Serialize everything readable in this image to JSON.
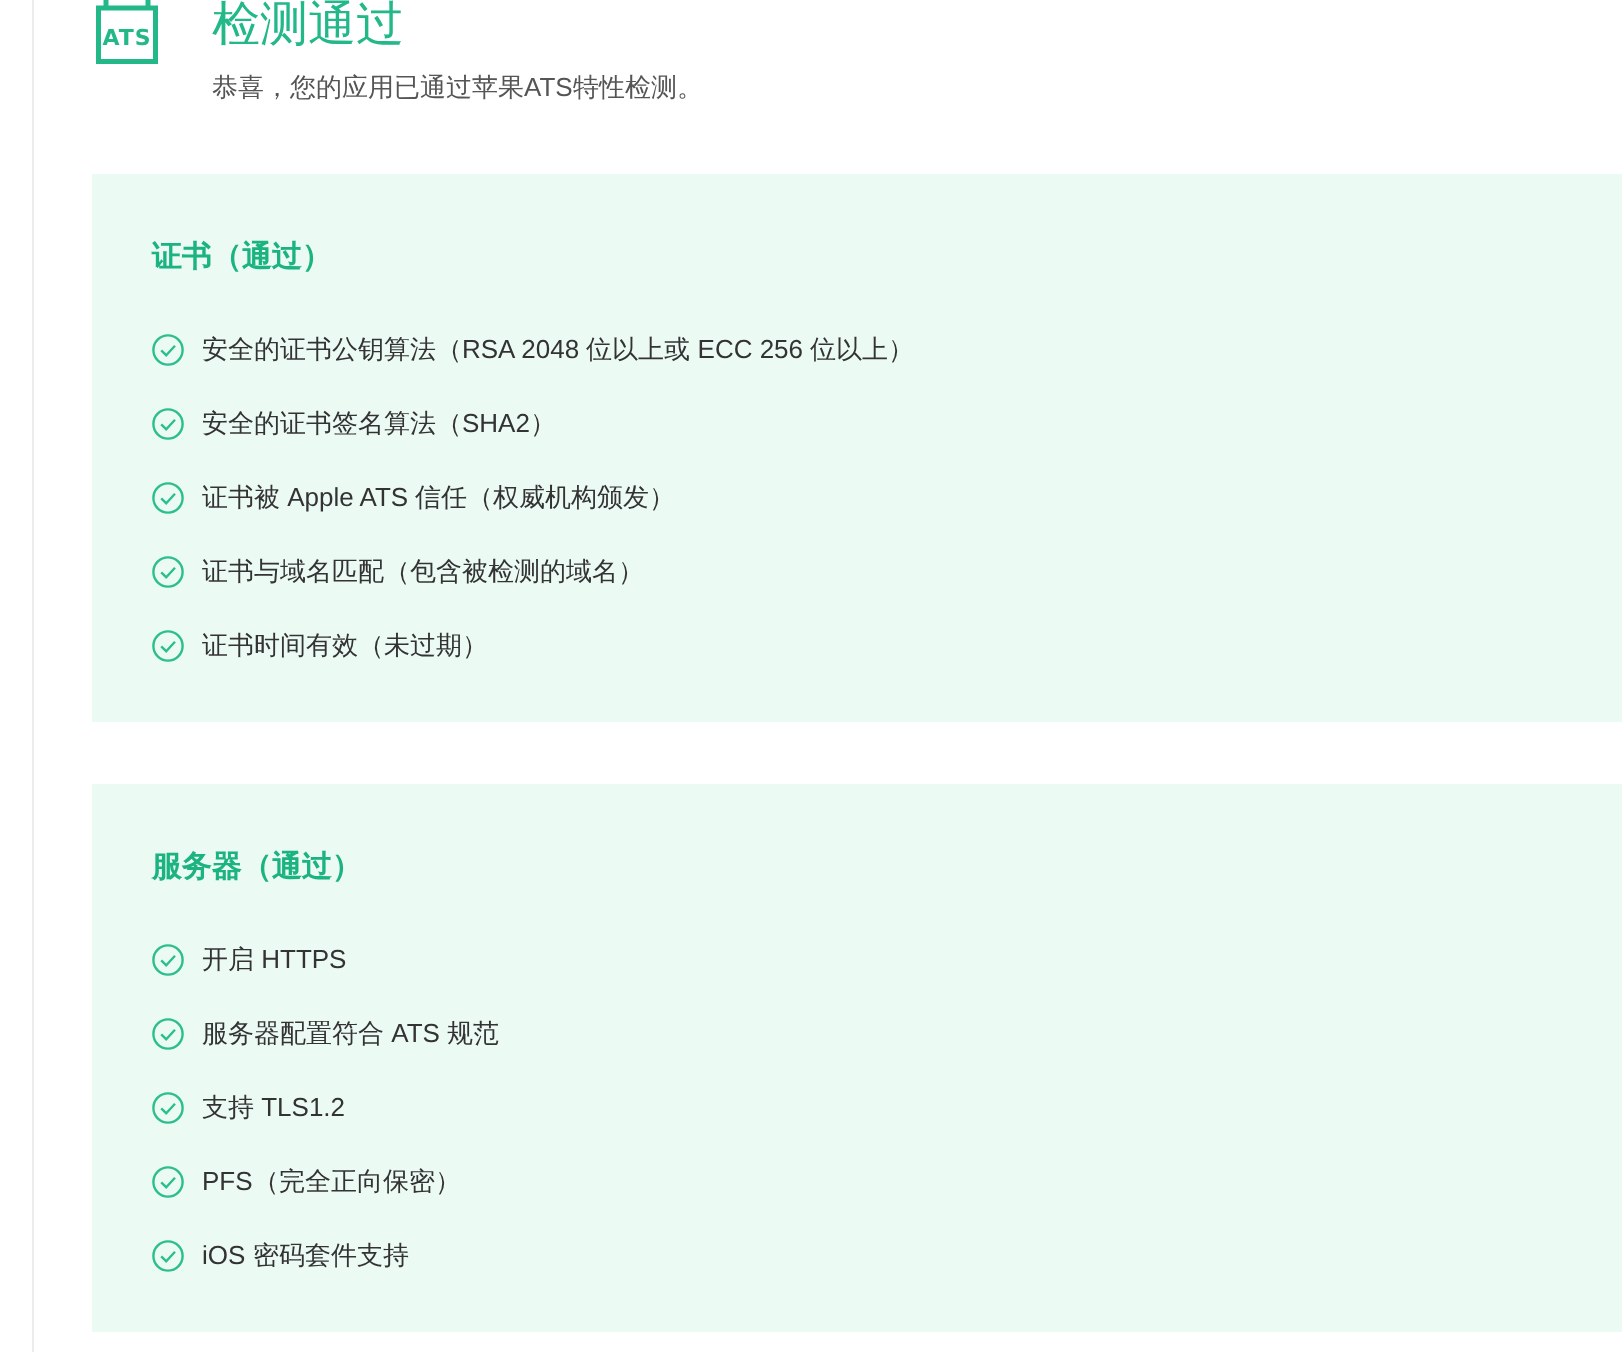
{
  "header": {
    "logo_text": "ATS",
    "title": "检测通过",
    "subtitle": "恭喜，您的应用已通过苹果ATS特性检测。"
  },
  "sections": [
    {
      "title": "证书（通过）",
      "items": [
        {
          "label": "安全的证书公钥算法（RSA 2048 位以上或 ECC 256 位以上）",
          "passed": true
        },
        {
          "label": "安全的证书签名算法（SHA2）",
          "passed": true
        },
        {
          "label": "证书被 Apple ATS 信任（权威机构颁发）",
          "passed": true
        },
        {
          "label": "证书与域名匹配（包含被检测的域名）",
          "passed": true
        },
        {
          "label": "证书时间有效（未过期）",
          "passed": true
        }
      ]
    },
    {
      "title": "服务器（通过）",
      "items": [
        {
          "label": "开启 HTTPS",
          "passed": true
        },
        {
          "label": "服务器配置符合 ATS 规范",
          "passed": true
        },
        {
          "label": "支持 TLS1.2",
          "passed": true
        },
        {
          "label": "PFS（完全正向保密）",
          "passed": true
        },
        {
          "label": "iOS 密码套件支持",
          "passed": true
        }
      ]
    }
  ]
}
